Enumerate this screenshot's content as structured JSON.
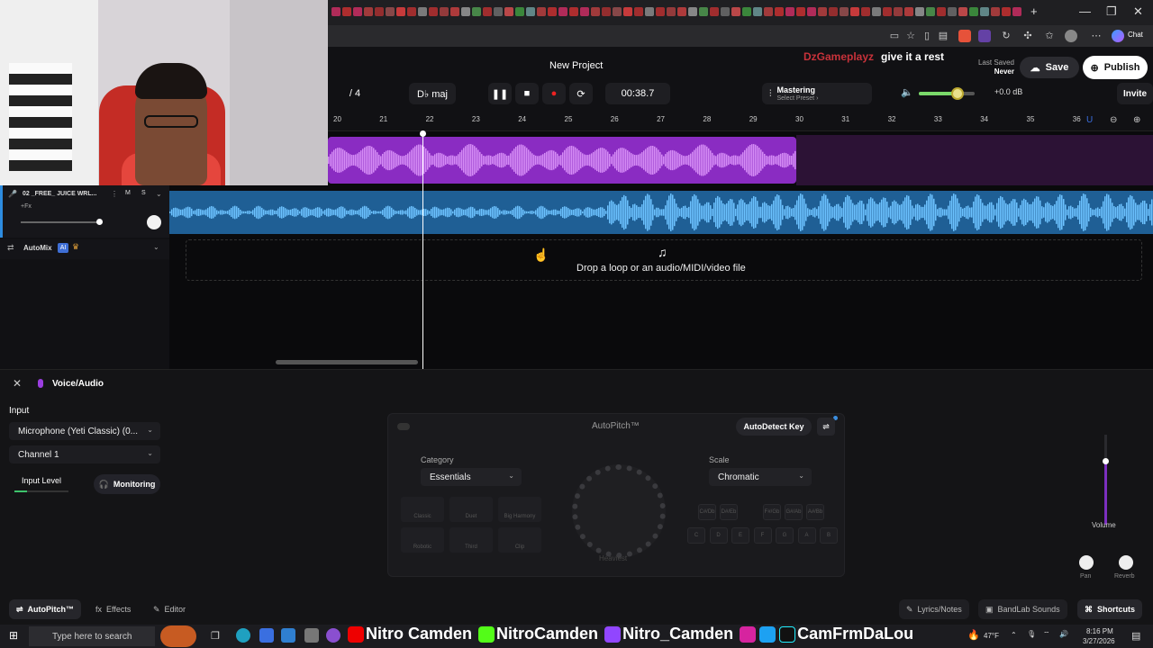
{
  "webcam": {
    "description_icon": "webcam-overlay"
  },
  "browser": {
    "tab_add": "+",
    "win_min": "—",
    "win_max": "❐",
    "win_close": "✕",
    "chat_label": "Chat"
  },
  "project": {
    "title": "New Project",
    "last_saved_label": "Last Saved",
    "last_saved_value": "Never",
    "save_label": "Save",
    "publish_label": "Publish",
    "invite_label": "Invite",
    "notif_count": "1"
  },
  "chat_overlay": {
    "user": "DzGameplayz",
    "message": "give it a rest"
  },
  "transport": {
    "time_signature": "/ 4",
    "key": "D♭ maj",
    "time": "00:38.7",
    "mastering_label": "Mastering",
    "mastering_preset": "Select Preset ›",
    "volume_db": "+0.0 dB",
    "volume_level": 0.7
  },
  "ruler": {
    "ticks": [
      "20",
      "21",
      "22",
      "23",
      "24",
      "25",
      "26",
      "27",
      "28",
      "29",
      "30",
      "31",
      "32",
      "33",
      "34",
      "35",
      "36"
    ]
  },
  "tracks": [
    {
      "name": "02 _FREE_ JUICE WRL...",
      "fx": "+Fx",
      "mute": "M",
      "solo": "S"
    },
    {
      "name": "AutoMix",
      "ai_badge": "AI"
    }
  ],
  "dropzone": {
    "text": "Drop a loop or an audio/MIDI/video file"
  },
  "panel": {
    "title": "Voice/Audio",
    "input_label": "Input",
    "mic": "Microphone (Yeti Classic) (0...",
    "channel": "Channel 1",
    "input_level_label": "Input Level",
    "monitoring_label": "Monitoring"
  },
  "autopitch": {
    "title": "AutoPitch™",
    "autodetect_label": "AutoDetect Key",
    "category_label": "Category",
    "category_value": "Essentials",
    "scale_label": "Scale",
    "scale_value": "Chromatic",
    "dial_label": "Heaviest",
    "presets": [
      "Classic",
      "Duet",
      "Big Harmony",
      "Robotic",
      "Third",
      "Clip"
    ],
    "keys_top": [
      "C#\nDb",
      "D#\nEb",
      "F#\nGb",
      "G#\nAb",
      "A#\nBb"
    ],
    "keys_bottom": [
      "C",
      "D",
      "E",
      "F",
      "G",
      "A",
      "B"
    ]
  },
  "mixer": {
    "volume_label": "Volume",
    "pan_label": "Pan",
    "reverb_label": "Reverb"
  },
  "bottom_tabs": {
    "autopitch": "AutoPitch™",
    "effects": "Effects",
    "editor": "Editor",
    "lyrics": "Lyrics/Notes",
    "sounds": "BandLab Sounds",
    "shortcuts": "Shortcuts"
  },
  "taskbar": {
    "search_placeholder": "Type here to search",
    "social_1": "Nitro Camden",
    "social_2": "NitroCamden",
    "social_3": "Nitro_Camden",
    "social_4": "CamFrmDaLou",
    "temperature": "47°F",
    "clock_time": "8:16 PM",
    "clock_date": "3/27/2026"
  }
}
